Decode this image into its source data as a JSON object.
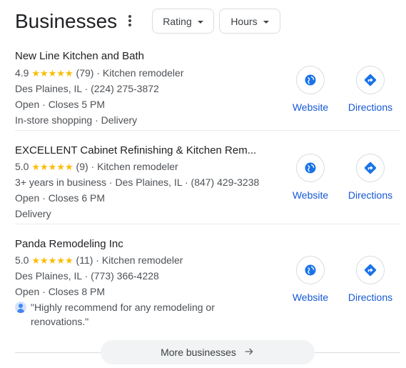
{
  "header": {
    "title": "Businesses",
    "filters": [
      {
        "label": "Rating"
      },
      {
        "label": "Hours"
      }
    ]
  },
  "listings": [
    {
      "name": "New Line Kitchen and Bath",
      "rating": "4.9",
      "stars": "★★★★★",
      "reviews": "(79)",
      "category": "· Kitchen remodeler",
      "line2": "Des Plaines, IL · (224) 275-3872",
      "line3": "Open · Closes 5 PM",
      "line4": "In-store shopping · Delivery",
      "website_label": "Website",
      "directions_label": "Directions"
    },
    {
      "name": "EXCELLENT Cabinet Refinishing & Kitchen Rem...",
      "rating": "5.0",
      "stars": "★★★★★",
      "reviews": "(9)",
      "category": "· Kitchen remodeler",
      "line2": "3+ years in business · Des Plaines, IL · (847) 429-3238",
      "line3": "Open · Closes 6 PM",
      "line4": "Delivery",
      "website_label": "Website",
      "directions_label": "Directions"
    },
    {
      "name": "Panda Remodeling Inc",
      "rating": "5.0",
      "stars": "★★★★★",
      "reviews": "(11)",
      "category": "· Kitchen remodeler",
      "line2": "Des Plaines, IL · (773) 366-4228",
      "line3": "Open · Closes 8 PM",
      "review": "\"Highly recommend for any remodeling or renovations.\"",
      "website_label": "Website",
      "directions_label": "Directions"
    }
  ],
  "more": {
    "label": "More businesses"
  },
  "colors": {
    "star": "#fbbc04",
    "link": "#1558d6",
    "icon": "#1a73e8"
  }
}
